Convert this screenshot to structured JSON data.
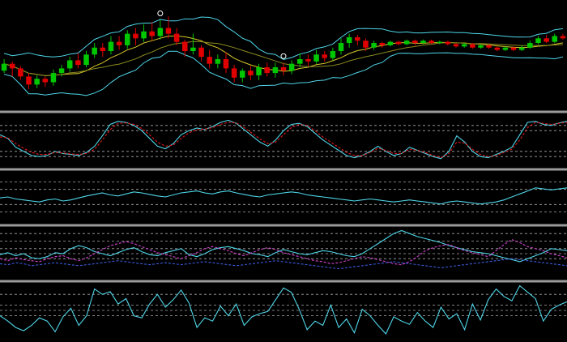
{
  "colors": {
    "background": "#000000",
    "separator": "#9a9a9a",
    "band": "#4fd6e8",
    "ma_yellow": "#d8c828",
    "ma_olive": "#8a8a20",
    "candle_up": "#00c800",
    "candle_down": "#e00000",
    "grid": "#c8c8c8",
    "line_cyan": "#4fd6e8",
    "line_red": "#e01818",
    "line_magenta": "#d040d0",
    "line_blue": "#3a5ad8",
    "marker": "#ffffff"
  },
  "chart_data": [
    {
      "type": "candlestick",
      "pane": "price",
      "overlays": [
        "bollinger-bands",
        "moving-average",
        "moving-average"
      ],
      "markers": [
        "fractal-up",
        "fractal-up"
      ],
      "candles": [
        {
          "o": 38,
          "c": 44,
          "h": 36,
          "l": 48
        },
        {
          "o": 44,
          "c": 40,
          "h": 33,
          "l": 46
        },
        {
          "o": 40,
          "c": 33,
          "h": 30,
          "l": 42
        },
        {
          "o": 33,
          "c": 26,
          "h": 22,
          "l": 36
        },
        {
          "o": 26,
          "c": 31,
          "h": 23,
          "l": 34
        },
        {
          "o": 31,
          "c": 28,
          "h": 24,
          "l": 33
        },
        {
          "o": 28,
          "c": 36,
          "h": 25,
          "l": 39
        },
        {
          "o": 36,
          "c": 40,
          "h": 33,
          "l": 43
        },
        {
          "o": 40,
          "c": 47,
          "h": 37,
          "l": 50
        },
        {
          "o": 47,
          "c": 43,
          "h": 40,
          "l": 53
        },
        {
          "o": 43,
          "c": 52,
          "h": 41,
          "l": 55
        },
        {
          "o": 52,
          "c": 58,
          "h": 49,
          "l": 62
        },
        {
          "o": 58,
          "c": 55,
          "h": 50,
          "l": 62
        },
        {
          "o": 55,
          "c": 63,
          "h": 52,
          "l": 68
        },
        {
          "o": 63,
          "c": 60,
          "h": 56,
          "l": 68
        },
        {
          "o": 60,
          "c": 70,
          "h": 57,
          "l": 73
        },
        {
          "o": 70,
          "c": 66,
          "h": 60,
          "l": 75
        },
        {
          "o": 66,
          "c": 72,
          "h": 63,
          "l": 78
        },
        {
          "o": 72,
          "c": 68,
          "h": 64,
          "l": 80
        },
        {
          "o": 68,
          "c": 75,
          "h": 65,
          "l": 82
        },
        {
          "o": 75,
          "c": 70,
          "h": 66,
          "l": 85
        },
        {
          "o": 70,
          "c": 63,
          "h": 60,
          "l": 75
        },
        {
          "o": 63,
          "c": 55,
          "h": 50,
          "l": 65
        },
        {
          "o": 55,
          "c": 58,
          "h": 52,
          "l": 70
        },
        {
          "o": 58,
          "c": 50,
          "h": 46,
          "l": 60
        },
        {
          "o": 50,
          "c": 44,
          "h": 40,
          "l": 56
        },
        {
          "o": 44,
          "c": 48,
          "h": 40,
          "l": 52
        },
        {
          "o": 48,
          "c": 40,
          "h": 36,
          "l": 54
        },
        {
          "o": 40,
          "c": 32,
          "h": 28,
          "l": 43
        },
        {
          "o": 32,
          "c": 38,
          "h": 28,
          "l": 40
        },
        {
          "o": 38,
          "c": 34,
          "h": 30,
          "l": 42
        },
        {
          "o": 34,
          "c": 41,
          "h": 30,
          "l": 44
        },
        {
          "o": 41,
          "c": 36,
          "h": 33,
          "l": 45
        },
        {
          "o": 36,
          "c": 41,
          "h": 32,
          "l": 45
        },
        {
          "o": 41,
          "c": 38,
          "h": 34,
          "l": 45
        },
        {
          "o": 38,
          "c": 44,
          "h": 35,
          "l": 47
        },
        {
          "o": 44,
          "c": 48,
          "h": 41,
          "l": 53
        },
        {
          "o": 48,
          "c": 46,
          "h": 42,
          "l": 52
        },
        {
          "o": 46,
          "c": 52,
          "h": 44,
          "l": 56
        },
        {
          "o": 52,
          "c": 49,
          "h": 46,
          "l": 55
        },
        {
          "o": 49,
          "c": 55,
          "h": 47,
          "l": 58
        },
        {
          "o": 55,
          "c": 62,
          "h": 52,
          "l": 66
        },
        {
          "o": 62,
          "c": 67,
          "h": 58,
          "l": 70
        },
        {
          "o": 67,
          "c": 64,
          "h": 60,
          "l": 69
        },
        {
          "o": 64,
          "c": 58,
          "h": 55,
          "l": 66
        },
        {
          "o": 58,
          "c": 62,
          "h": 56,
          "l": 64
        },
        {
          "o": 62,
          "c": 60,
          "h": 58,
          "l": 63
        },
        {
          "o": 60,
          "c": 63,
          "h": 59,
          "l": 64
        },
        {
          "o": 63,
          "c": 61,
          "h": 60,
          "l": 64
        },
        {
          "o": 61,
          "c": 64,
          "h": 60,
          "l": 65
        },
        {
          "o": 64,
          "c": 62,
          "h": 60,
          "l": 65
        },
        {
          "o": 62,
          "c": 64,
          "h": 61,
          "l": 65
        },
        {
          "o": 64,
          "c": 62,
          "h": 61,
          "l": 65
        },
        {
          "o": 62,
          "c": 63,
          "h": 61,
          "l": 64
        },
        {
          "o": 63,
          "c": 61,
          "h": 60,
          "l": 64
        },
        {
          "o": 61,
          "c": 59,
          "h": 58,
          "l": 62
        },
        {
          "o": 59,
          "c": 61,
          "h": 58,
          "l": 62
        },
        {
          "o": 61,
          "c": 58,
          "h": 57,
          "l": 62
        },
        {
          "o": 58,
          "c": 60,
          "h": 57,
          "l": 61
        },
        {
          "o": 60,
          "c": 58,
          "h": 57,
          "l": 61
        },
        {
          "o": 58,
          "c": 56,
          "h": 55,
          "l": 59
        },
        {
          "o": 56,
          "c": 58,
          "h": 55,
          "l": 59
        },
        {
          "o": 58,
          "c": 56,
          "h": 55,
          "l": 59
        },
        {
          "o": 56,
          "c": 58,
          "h": 55,
          "l": 60
        },
        {
          "o": 58,
          "c": 62,
          "h": 57,
          "l": 64
        },
        {
          "o": 62,
          "c": 66,
          "h": 61,
          "l": 68
        },
        {
          "o": 66,
          "c": 63,
          "h": 62,
          "l": 69
        },
        {
          "o": 63,
          "c": 68,
          "h": 62,
          "l": 70
        },
        {
          "o": 68,
          "c": 66,
          "h": 65,
          "l": 70
        }
      ]
    },
    {
      "type": "line",
      "pane": "oscillator-1",
      "levels": [
        80,
        70,
        30,
        20
      ],
      "ylim": [
        0,
        100
      ],
      "series": [
        {
          "color_key": "line_cyan",
          "dash": false,
          "values": [
            62,
            55,
            38,
            30,
            22,
            20,
            22,
            30,
            26,
            24,
            22,
            28,
            40,
            60,
            82,
            88,
            86,
            80,
            70,
            55,
            40,
            35,
            45,
            62,
            70,
            75,
            72,
            78,
            86,
            90,
            84,
            72,
            60,
            48,
            40,
            52,
            70,
            82,
            84,
            78,
            65,
            52,
            42,
            32,
            22,
            18,
            22,
            30,
            40,
            30,
            22,
            26,
            38,
            32,
            26,
            20,
            16,
            30,
            60,
            48,
            30,
            20,
            18,
            24,
            30,
            38,
            62,
            86,
            88,
            82,
            80,
            85,
            88
          ]
        },
        {
          "color_key": "line_red",
          "dash": true,
          "values": [
            58,
            56,
            45,
            36,
            28,
            24,
            24,
            28,
            27,
            25,
            24,
            26,
            34,
            52,
            72,
            84,
            85,
            82,
            74,
            62,
            48,
            40,
            42,
            55,
            66,
            72,
            73,
            76,
            82,
            86,
            85,
            76,
            65,
            54,
            45,
            48,
            62,
            76,
            82,
            80,
            70,
            58,
            48,
            38,
            28,
            22,
            22,
            28,
            36,
            32,
            26,
            26,
            34,
            32,
            28,
            22,
            18,
            26,
            48,
            46,
            34,
            24,
            20,
            22,
            28,
            34,
            52,
            76,
            86,
            84,
            82,
            84,
            86
          ]
        }
      ]
    },
    {
      "type": "line",
      "pane": "oscillator-2",
      "levels": [
        80,
        65,
        35,
        20
      ],
      "ylim": [
        0,
        100
      ],
      "series": [
        {
          "color_key": "line_cyan",
          "dash": false,
          "values": [
            48,
            50,
            46,
            44,
            42,
            40,
            44,
            46,
            42,
            44,
            48,
            52,
            55,
            58,
            54,
            52,
            56,
            60,
            58,
            55,
            52,
            50,
            54,
            58,
            60,
            62,
            58,
            56,
            60,
            62,
            58,
            55,
            52,
            50,
            54,
            56,
            58,
            60,
            58,
            54,
            52,
            50,
            48,
            46,
            44,
            42,
            44,
            46,
            44,
            42,
            40,
            42,
            44,
            42,
            40,
            38,
            36,
            40,
            42,
            40,
            38,
            36,
            38,
            40,
            44,
            50,
            56,
            62,
            68,
            66,
            64,
            66,
            68
          ]
        }
      ]
    },
    {
      "type": "line",
      "pane": "oscillator-3",
      "levels": [
        90,
        75,
        60,
        50,
        40
      ],
      "ylim": [
        0,
        100
      ],
      "series": [
        {
          "color_key": "line_cyan",
          "dash": false,
          "values": [
            48,
            52,
            46,
            50,
            42,
            40,
            44,
            52,
            50,
            60,
            66,
            62,
            54,
            50,
            46,
            52,
            58,
            62,
            54,
            48,
            46,
            52,
            56,
            60,
            48,
            44,
            50,
            58,
            62,
            64,
            60,
            56,
            50,
            48,
            44,
            52,
            58,
            54,
            50,
            48,
            52,
            56,
            54,
            50,
            46,
            44,
            50,
            60,
            70,
            80,
            90,
            96,
            90,
            84,
            80,
            76,
            72,
            66,
            62,
            58,
            54,
            52,
            50,
            46,
            42,
            38,
            34,
            40,
            46,
            52,
            60,
            58,
            56
          ]
        },
        {
          "color_key": "line_magenta",
          "dash": true,
          "values": [
            40,
            36,
            42,
            38,
            36,
            34,
            40,
            44,
            46,
            40,
            36,
            42,
            50,
            58,
            66,
            70,
            74,
            70,
            64,
            58,
            52,
            48,
            44,
            40,
            46,
            52,
            60,
            64,
            60,
            56,
            50,
            46,
            52,
            58,
            62,
            58,
            52,
            48,
            44,
            40,
            36,
            34,
            30,
            32,
            36,
            40,
            44,
            42,
            38,
            34,
            30,
            28,
            34,
            44,
            56,
            62,
            66,
            68,
            62,
            56,
            52,
            48,
            44,
            56,
            68,
            78,
            72,
            64,
            60,
            56,
            50,
            46,
            42
          ]
        },
        {
          "color_key": "line_blue",
          "dash": true,
          "values": [
            30,
            28,
            32,
            30,
            26,
            28,
            30,
            32,
            30,
            28,
            26,
            28,
            30,
            32,
            34,
            36,
            34,
            32,
            30,
            28,
            30,
            32,
            30,
            28,
            30,
            32,
            34,
            32,
            30,
            28,
            26,
            28,
            30,
            32,
            34,
            36,
            34,
            32,
            30,
            28,
            26,
            24,
            22,
            20,
            22,
            24,
            26,
            28,
            30,
            32,
            34,
            32,
            30,
            28,
            26,
            24,
            22,
            24,
            26,
            28,
            30,
            32,
            34,
            36,
            38,
            40,
            38,
            36,
            34,
            32,
            30,
            28,
            26
          ]
        }
      ]
    },
    {
      "type": "line",
      "pane": "oscillator-4",
      "levels": [
        80,
        60,
        50,
        40
      ],
      "ylim": [
        0,
        100
      ],
      "series": [
        {
          "color_key": "line_cyan",
          "dash": false,
          "values": [
            40,
            30,
            18,
            12,
            22,
            36,
            30,
            10,
            38,
            54,
            22,
            40,
            90,
            80,
            85,
            62,
            72,
            40,
            36,
            62,
            80,
            56,
            70,
            88,
            64,
            18,
            36,
            30,
            58,
            40,
            62,
            22,
            38,
            44,
            48,
            70,
            92,
            84,
            52,
            14,
            30,
            22,
            60,
            18,
            34,
            8,
            52,
            40,
            22,
            6,
            38,
            30,
            24,
            46,
            30,
            18,
            56,
            34,
            44,
            14,
            62,
            32,
            70,
            90,
            76,
            68,
            96,
            84,
            72,
            30,
            52,
            60,
            66
          ]
        }
      ]
    }
  ]
}
